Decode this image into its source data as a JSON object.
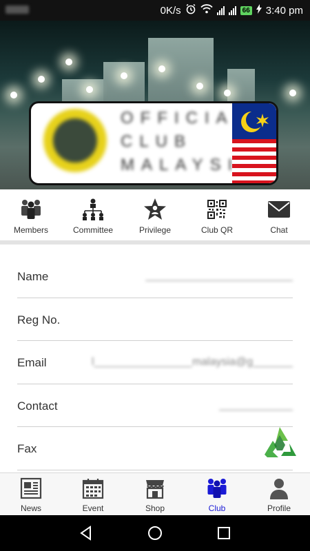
{
  "status_bar": {
    "net_speed": "0K/s",
    "battery_level": "66",
    "time": "3:40 pm"
  },
  "shortcuts": [
    {
      "label": "Members",
      "icon": "members-icon"
    },
    {
      "label": "Committee",
      "icon": "committee-icon"
    },
    {
      "label": "Privilege",
      "icon": "privilege-star-icon"
    },
    {
      "label": "Club QR",
      "icon": "qr-code-icon"
    },
    {
      "label": "Chat",
      "icon": "envelope-icon"
    }
  ],
  "profile_rows": [
    {
      "label": "Name",
      "value": "________________________"
    },
    {
      "label": "Reg No.",
      "value": ""
    },
    {
      "label": "Email",
      "value": "l________________malaysia@g__________"
    },
    {
      "label": "Contact",
      "value": "____________"
    },
    {
      "label": "Fax",
      "value": ""
    }
  ],
  "tabs": [
    {
      "label": "News",
      "icon": "newspaper-icon",
      "active": false
    },
    {
      "label": "Event",
      "icon": "calendar-icon",
      "active": false
    },
    {
      "label": "Shop",
      "icon": "shop-icon",
      "active": false
    },
    {
      "label": "Club",
      "icon": "club-members-icon",
      "active": true
    },
    {
      "label": "Profile",
      "icon": "person-icon",
      "active": false
    }
  ],
  "colors": {
    "active_tab": "#1a1ad6",
    "inactive_icon": "#444444",
    "fab_green": "#3aa84a"
  }
}
